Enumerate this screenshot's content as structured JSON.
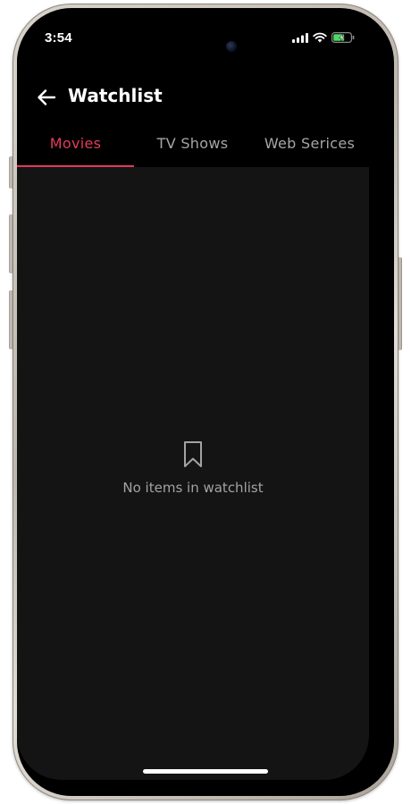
{
  "status_bar": {
    "time": "3:54"
  },
  "header": {
    "title": "Watchlist",
    "back_icon": "arrow-left-icon"
  },
  "tabs": [
    {
      "label": "Movies",
      "active": true
    },
    {
      "label": "TV Shows",
      "active": false
    },
    {
      "label": "Web Serices",
      "active": false
    }
  ],
  "empty_state": {
    "icon": "bookmark-icon",
    "message": "No items in watchlist"
  },
  "colors": {
    "accent": "#e23b5a",
    "background": "#000000",
    "content_background": "#141414",
    "inactive_text": "#a6a6a6"
  }
}
